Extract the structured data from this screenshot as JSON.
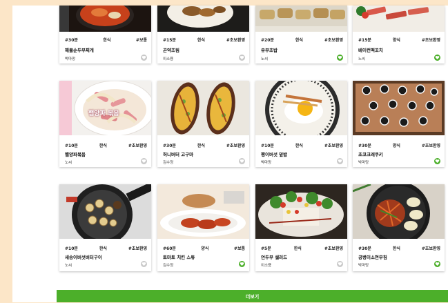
{
  "cards": [
    {
      "meta": [
        "#30분",
        "한식",
        "#보통"
      ],
      "title": "해물순두부찌개",
      "author": "박마망",
      "liked": false
    },
    {
      "meta": [
        "#15분",
        "한식",
        "#초보환영"
      ],
      "title": "곤약조림",
      "author": "이소용",
      "liked": false
    },
    {
      "meta": [
        "#20분",
        "한식",
        "#초보환영"
      ],
      "title": "유부초밥",
      "author": "노씨",
      "liked": true
    },
    {
      "meta": [
        "#15분",
        "양식",
        "#초보환영"
      ],
      "title": "베이컨떡꼬치",
      "author": "노씨",
      "liked": true
    },
    {
      "meta": [
        "#10분",
        "한식",
        "#초보환영"
      ],
      "title": "햄양파볶음",
      "author": "노씨",
      "liked": false
    },
    {
      "meta": [
        "#30분",
        "한식",
        "#초보환영"
      ],
      "title": "허니버터 고구마",
      "author": "김수정",
      "liked": false
    },
    {
      "meta": [
        "#10분",
        "한식",
        "#초보환영"
      ],
      "title": "팽이버섯 덮밥",
      "author": "박마망",
      "liked": false
    },
    {
      "meta": [
        "#30분",
        "양식",
        "#초보환영"
      ],
      "title": "초코크래쿠키",
      "author": "박마망",
      "liked": true
    },
    {
      "meta": [
        "#10분",
        "한식",
        "#초보환영"
      ],
      "title": "새송이버섯버터구이",
      "author": "노씨",
      "liked": false
    },
    {
      "meta": [
        "#60분",
        "양식",
        "#보통"
      ],
      "title": "토마토 치킨 스튜",
      "author": "김수정",
      "liked": true
    },
    {
      "meta": [
        "#5분",
        "한식",
        "#초보환영"
      ],
      "title": "연두부 샐러드",
      "author": "이소용",
      "liked": false
    },
    {
      "meta": [
        "#30분",
        "한식",
        "#초보환영"
      ],
      "title": "공병이소면무침",
      "author": "박마망",
      "liked": true
    }
  ],
  "thumb_text": "햄양파 볶음",
  "more_label": "더보기",
  "colors": {
    "accent": "#4caf2a",
    "background": "#fce6c8",
    "like_on": "#4caf2a",
    "like_off": "#c8c8c8"
  }
}
